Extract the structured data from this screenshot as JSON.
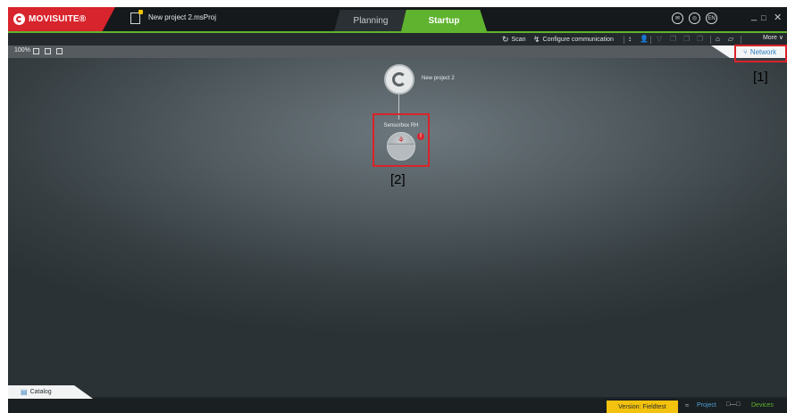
{
  "app": {
    "brand": "MOVISUITE®",
    "project_file": "New project 2.msProj"
  },
  "tabs": {
    "planning": "Planning",
    "startup": "Startup"
  },
  "header_buttons": {
    "btn1": "✉",
    "btn2": "◎",
    "lang": "EN",
    "minimize": "_",
    "maximize": "□",
    "close": "✕"
  },
  "toolbar": {
    "scan": "Scan",
    "configure": "Configure communication",
    "more": "More ∨"
  },
  "subbar": {
    "zoom": "100%"
  },
  "network_tab": {
    "label": "Network"
  },
  "tree": {
    "root_label": "New project 2",
    "device_label": "Sensorbox RH",
    "device_error": "!"
  },
  "markers": {
    "m1": "[1]",
    "m2": "[2]"
  },
  "catalog": {
    "label": "Catalog"
  },
  "status": {
    "version": "Version: Fieldtest",
    "project": "Project",
    "devices": "Devices"
  },
  "colors": {
    "accent_green": "#5fb32e",
    "brand_red": "#d8242c",
    "highlight_red": "#d9232a",
    "version_yellow": "#f2c20e"
  }
}
